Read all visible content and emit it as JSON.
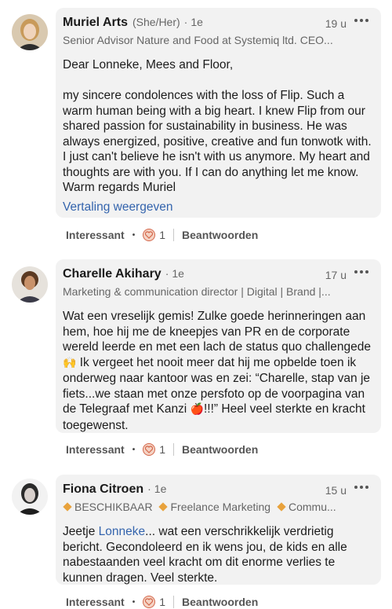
{
  "comments": [
    {
      "name": "Muriel Arts",
      "pronoun": "(She/Her)",
      "separator": "·",
      "degree": "1e",
      "time": "19 u",
      "headline": "Senior Advisor Nature and Food at Systemiq ltd. CEO...",
      "greeting": "Dear Lonneke, Mees and Floor,",
      "body": "my sincere condolences with the loss of Flip. Such a warm human being with a big heart. I knew Flip from our shared passion for sustainability in business. He was always energized, positive, creative and fun tonwotk with. I just can't believe he isn't with us anymore. My heart and thoughts are with you. If I can do anything let me know. Warm regards Muriel",
      "translate": "Vertaling weergeven",
      "reaction_label": "Interessant",
      "reaction_count": "1",
      "reply_label": "Beantwoorden"
    },
    {
      "name": "Charelle Akihary",
      "separator": "·",
      "degree": "1e",
      "time": "17 u",
      "headline": "Marketing & communication director | Digital | Brand |...",
      "body_1": "Wat een vreselijk gemis! Zulke goede herinneringen aan hem, hoe hij me de kneepjes van PR en de corporate wereld leerde en met een lach de status quo challengede ",
      "emoji_1": "🙌",
      "body_2": " Ik vergeet het nooit meer dat hij me opbelde toen ik onderweg naar kantoor was en zei: “Charelle, stap van je fiets...we staan met onze persfoto op de voorpagina van de Telegraaf met Kanzi ",
      "emoji_2": "🍎",
      "body_3": "!!!” Heel veel sterkte en kracht toegewenst.",
      "reaction_label": "Interessant",
      "reaction_count": "1",
      "reply_label": "Beantwoorden"
    },
    {
      "name": "Fiona Citroen",
      "separator": "·",
      "degree": "1e",
      "time": "15 u",
      "headline_tags": [
        "BESCHIKBAAR",
        "Freelance Marketing",
        "Commu..."
      ],
      "body_pre": "Jeetje ",
      "mention": "Lonneke",
      "body_post": "... wat een verschrikkelijk verdrietig bericht. Gecondoleerd en ik wens jou, de kids en alle nabestaanden veel kracht om dit enorme verlies te kunnen dragen. Veel sterkte.",
      "reaction_label": "Interessant",
      "reaction_count": "1",
      "reply_label": "Beantwoorden"
    }
  ],
  "icons": {
    "more": "more-horizontal-icon",
    "reaction": "heart-reaction-icon",
    "tag": "orange-diamond-icon"
  },
  "colors": {
    "bubble": "#f2f2f2",
    "link": "#3464ad",
    "tag": "#e8a23c",
    "reaction_bg": "#f4d3c4",
    "reaction_heart": "#d4664a"
  }
}
